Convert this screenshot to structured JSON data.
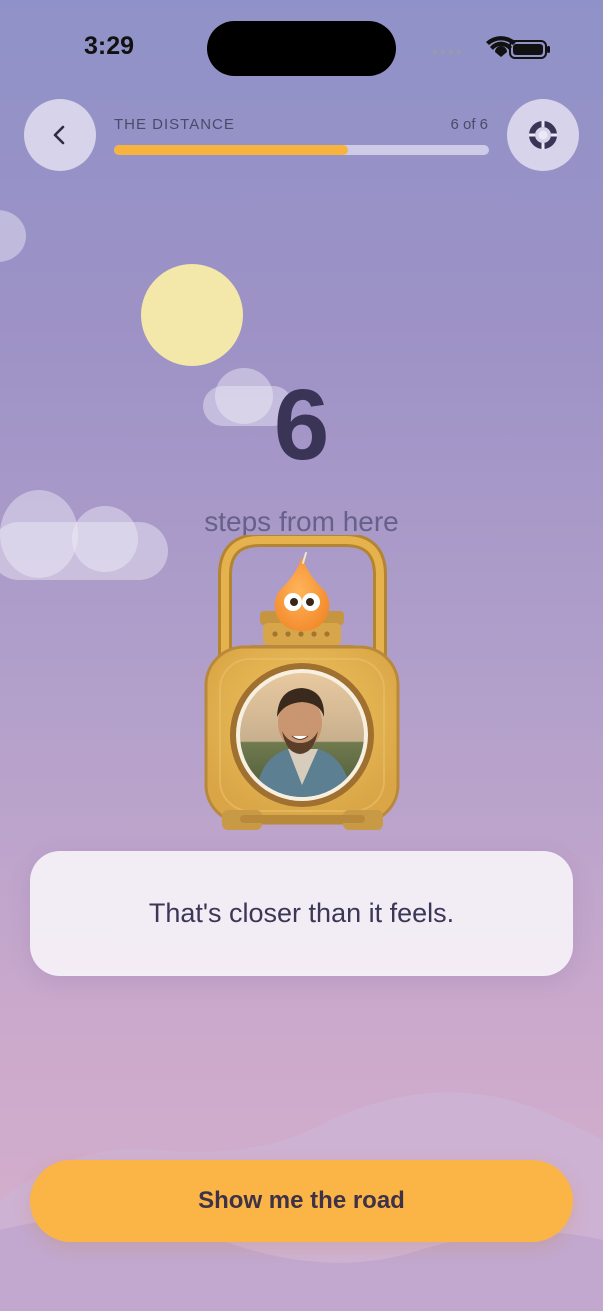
{
  "status_bar": {
    "time": "3:29"
  },
  "header": {
    "progress_title": "THE DISTANCE",
    "progress_count": "6 of 6",
    "progress_fraction": 0.625
  },
  "main": {
    "steps_number": "6",
    "steps_text": "steps from here",
    "message": "That's closer than it feels."
  },
  "cta": {
    "label": "Show me the road"
  },
  "colors": {
    "accent": "#fbb546",
    "progress_fill": "#f6b43f",
    "number_text": "#3a3557"
  },
  "icons": {
    "back": "chevron-left-icon",
    "settings": "lifebuoy-icon",
    "character": "flame-character-icon"
  }
}
